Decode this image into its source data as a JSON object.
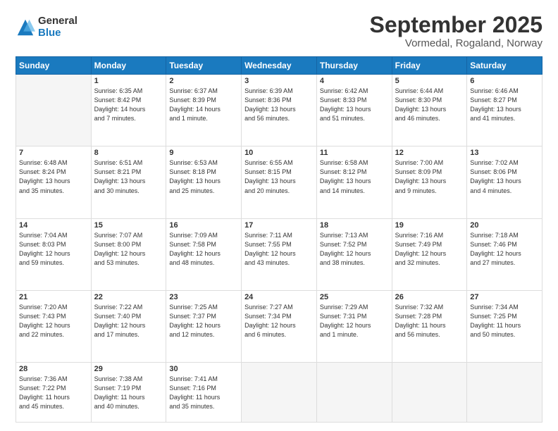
{
  "logo": {
    "general": "General",
    "blue": "Blue"
  },
  "title": "September 2025",
  "location": "Vormedal, Rogaland, Norway",
  "headers": [
    "Sunday",
    "Monday",
    "Tuesday",
    "Wednesday",
    "Thursday",
    "Friday",
    "Saturday"
  ],
  "weeks": [
    [
      {
        "day": "",
        "info": ""
      },
      {
        "day": "1",
        "info": "Sunrise: 6:35 AM\nSunset: 8:42 PM\nDaylight: 14 hours\nand 7 minutes."
      },
      {
        "day": "2",
        "info": "Sunrise: 6:37 AM\nSunset: 8:39 PM\nDaylight: 14 hours\nand 1 minute."
      },
      {
        "day": "3",
        "info": "Sunrise: 6:39 AM\nSunset: 8:36 PM\nDaylight: 13 hours\nand 56 minutes."
      },
      {
        "day": "4",
        "info": "Sunrise: 6:42 AM\nSunset: 8:33 PM\nDaylight: 13 hours\nand 51 minutes."
      },
      {
        "day": "5",
        "info": "Sunrise: 6:44 AM\nSunset: 8:30 PM\nDaylight: 13 hours\nand 46 minutes."
      },
      {
        "day": "6",
        "info": "Sunrise: 6:46 AM\nSunset: 8:27 PM\nDaylight: 13 hours\nand 41 minutes."
      }
    ],
    [
      {
        "day": "7",
        "info": "Sunrise: 6:48 AM\nSunset: 8:24 PM\nDaylight: 13 hours\nand 35 minutes."
      },
      {
        "day": "8",
        "info": "Sunrise: 6:51 AM\nSunset: 8:21 PM\nDaylight: 13 hours\nand 30 minutes."
      },
      {
        "day": "9",
        "info": "Sunrise: 6:53 AM\nSunset: 8:18 PM\nDaylight: 13 hours\nand 25 minutes."
      },
      {
        "day": "10",
        "info": "Sunrise: 6:55 AM\nSunset: 8:15 PM\nDaylight: 13 hours\nand 20 minutes."
      },
      {
        "day": "11",
        "info": "Sunrise: 6:58 AM\nSunset: 8:12 PM\nDaylight: 13 hours\nand 14 minutes."
      },
      {
        "day": "12",
        "info": "Sunrise: 7:00 AM\nSunset: 8:09 PM\nDaylight: 13 hours\nand 9 minutes."
      },
      {
        "day": "13",
        "info": "Sunrise: 7:02 AM\nSunset: 8:06 PM\nDaylight: 13 hours\nand 4 minutes."
      }
    ],
    [
      {
        "day": "14",
        "info": "Sunrise: 7:04 AM\nSunset: 8:03 PM\nDaylight: 12 hours\nand 59 minutes."
      },
      {
        "day": "15",
        "info": "Sunrise: 7:07 AM\nSunset: 8:00 PM\nDaylight: 12 hours\nand 53 minutes."
      },
      {
        "day": "16",
        "info": "Sunrise: 7:09 AM\nSunset: 7:58 PM\nDaylight: 12 hours\nand 48 minutes."
      },
      {
        "day": "17",
        "info": "Sunrise: 7:11 AM\nSunset: 7:55 PM\nDaylight: 12 hours\nand 43 minutes."
      },
      {
        "day": "18",
        "info": "Sunrise: 7:13 AM\nSunset: 7:52 PM\nDaylight: 12 hours\nand 38 minutes."
      },
      {
        "day": "19",
        "info": "Sunrise: 7:16 AM\nSunset: 7:49 PM\nDaylight: 12 hours\nand 32 minutes."
      },
      {
        "day": "20",
        "info": "Sunrise: 7:18 AM\nSunset: 7:46 PM\nDaylight: 12 hours\nand 27 minutes."
      }
    ],
    [
      {
        "day": "21",
        "info": "Sunrise: 7:20 AM\nSunset: 7:43 PM\nDaylight: 12 hours\nand 22 minutes."
      },
      {
        "day": "22",
        "info": "Sunrise: 7:22 AM\nSunset: 7:40 PM\nDaylight: 12 hours\nand 17 minutes."
      },
      {
        "day": "23",
        "info": "Sunrise: 7:25 AM\nSunset: 7:37 PM\nDaylight: 12 hours\nand 12 minutes."
      },
      {
        "day": "24",
        "info": "Sunrise: 7:27 AM\nSunset: 7:34 PM\nDaylight: 12 hours\nand 6 minutes."
      },
      {
        "day": "25",
        "info": "Sunrise: 7:29 AM\nSunset: 7:31 PM\nDaylight: 12 hours\nand 1 minute."
      },
      {
        "day": "26",
        "info": "Sunrise: 7:32 AM\nSunset: 7:28 PM\nDaylight: 11 hours\nand 56 minutes."
      },
      {
        "day": "27",
        "info": "Sunrise: 7:34 AM\nSunset: 7:25 PM\nDaylight: 11 hours\nand 50 minutes."
      }
    ],
    [
      {
        "day": "28",
        "info": "Sunrise: 7:36 AM\nSunset: 7:22 PM\nDaylight: 11 hours\nand 45 minutes."
      },
      {
        "day": "29",
        "info": "Sunrise: 7:38 AM\nSunset: 7:19 PM\nDaylight: 11 hours\nand 40 minutes."
      },
      {
        "day": "30",
        "info": "Sunrise: 7:41 AM\nSunset: 7:16 PM\nDaylight: 11 hours\nand 35 minutes."
      },
      {
        "day": "",
        "info": ""
      },
      {
        "day": "",
        "info": ""
      },
      {
        "day": "",
        "info": ""
      },
      {
        "day": "",
        "info": ""
      }
    ]
  ]
}
